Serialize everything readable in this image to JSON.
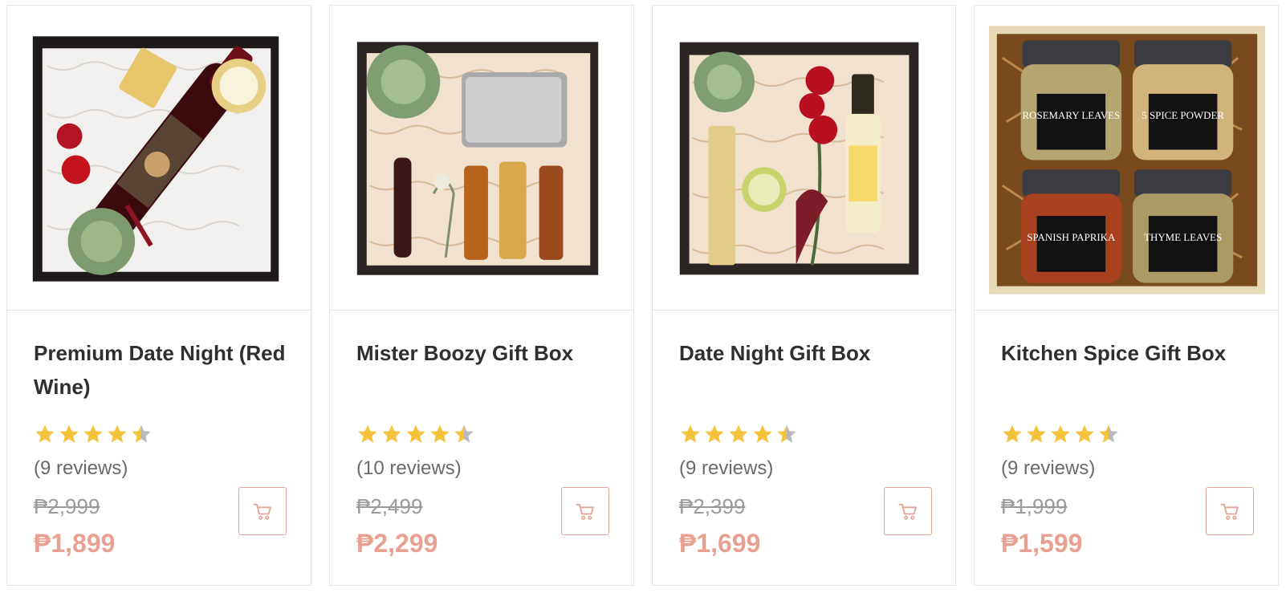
{
  "currency_symbol": "₱",
  "colors": {
    "star_fill": "#f5c33b",
    "star_empty": "#b9b9b9",
    "price_accent": "#e8a090",
    "old_price": "#9a9a9a",
    "cart_border": "#e3a595"
  },
  "products": [
    {
      "title": "Premium Date Night (Red Wine)",
      "rating": 4.5,
      "reviews": "(9 reviews)",
      "old_price": "₱2,999",
      "new_price": "₱1,899",
      "image_icon": "red-wine-gift-box-image",
      "cart_icon": "shopping-cart-icon"
    },
    {
      "title": "Mister Boozy Gift Box",
      "rating": 4.5,
      "reviews": "(10 reviews)",
      "old_price": "₱2,499",
      "new_price": "₱2,299",
      "image_icon": "liquor-flask-gift-box-image",
      "cart_icon": "shopping-cart-icon"
    },
    {
      "title": "Date Night Gift Box",
      "rating": 4.5,
      "reviews": "(9 reviews)",
      "old_price": "₱2,399",
      "new_price": "₱1,699",
      "image_icon": "white-wine-gift-box-image",
      "cart_icon": "shopping-cart-icon"
    },
    {
      "title": "Kitchen Spice Gift Box",
      "rating": 4.5,
      "reviews": "(9 reviews)",
      "old_price": "₱1,999",
      "new_price": "₱1,599",
      "image_icon": "spice-jars-gift-box-image",
      "cart_icon": "shopping-cart-icon",
      "jar_labels": [
        "ROSEMARY LEAVES",
        "5 SPICE POWDER",
        "SPANISH PAPRIKA",
        "THYME LEAVES"
      ]
    }
  ]
}
